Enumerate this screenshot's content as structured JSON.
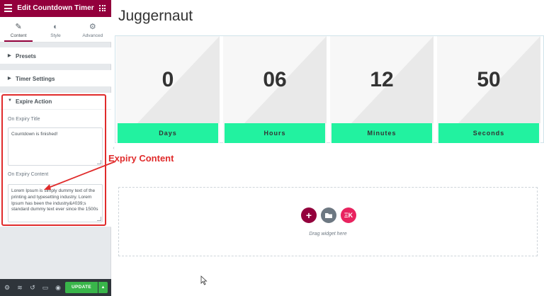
{
  "sidebar": {
    "title": "Edit Countdown Timer",
    "tabs": [
      {
        "label": "Content",
        "icon": "pencil-icon"
      },
      {
        "label": "Style",
        "icon": "half-circle-icon"
      },
      {
        "label": "Advanced",
        "icon": "gear-icon"
      }
    ],
    "sections": {
      "presets": "Presets",
      "timer_settings": "Timer Settings",
      "expire_action": "Expire Action"
    },
    "expiry_title_label": "On Expiry Title",
    "expiry_title_value": "Countdown is finished!",
    "expiry_content_label": "On Expiry Content",
    "expiry_content_value": "Lorem Ipsum is simply dummy text of the printing and typesetting industry. Lorem Ipsum has been the industry&#039;s standard dummy text ever since the 1500s",
    "footer": {
      "update_label": "UPDATE",
      "update_arrow": "▲"
    }
  },
  "preview": {
    "page_title": "Juggernaut",
    "countdown": [
      {
        "value": "0",
        "label": "Days"
      },
      {
        "value": "06",
        "label": "Hours"
      },
      {
        "value": "12",
        "label": "Minutes"
      },
      {
        "value": "50",
        "label": "Seconds"
      }
    ],
    "dropzone_text": "Drag widget here"
  },
  "annotation": {
    "text": "Expiry Content",
    "color": "#e02b2b"
  },
  "colors": {
    "brand": "#93003c",
    "accent_green": "#22f2a0",
    "update_green": "#39b54a"
  }
}
